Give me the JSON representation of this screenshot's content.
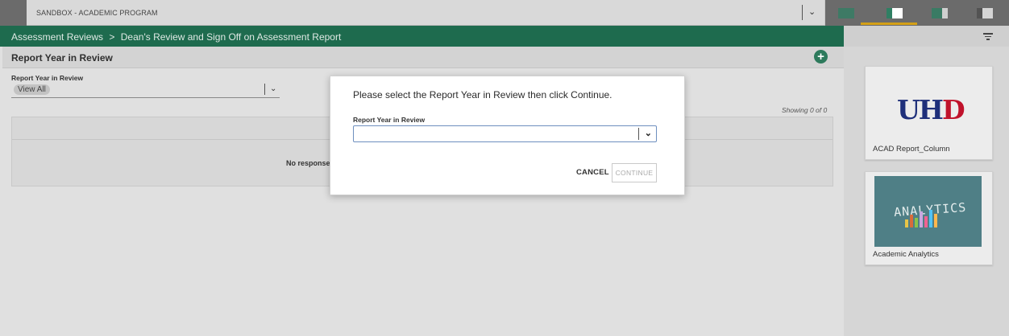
{
  "topbar": {
    "program_name": "SANDBOX - ACADEMIC PROGRAM",
    "menu_icon": "hamburger-menu-icon",
    "program_caret": "⌄",
    "view_buttons": [
      "layout-view-1-icon",
      "layout-view-2-icon",
      "layout-view-3-icon",
      "layout-view-4-icon"
    ],
    "active_view_index": 1
  },
  "breadcrumb": {
    "parent": "Assessment Reviews",
    "separator": ">",
    "current": "Dean's Review and Sign Off on Assessment Report"
  },
  "panel": {
    "title": "Report Year in Review",
    "add_icon": "plus-circle-icon",
    "add_label": "+",
    "filter_label": "Report Year in Review",
    "filter_value": "View All",
    "filter_caret": "⌄",
    "showing_text": "Showing 0 of 0",
    "empty_text": "No responses"
  },
  "sidebar": {
    "filter_icon": "filter-icon",
    "cards": [
      {
        "label": "ACAD Report_Column",
        "logo_text_main": "UH",
        "logo_text_accent": "D"
      },
      {
        "label": "Academic Analytics",
        "image_text": "ANALYTICS"
      }
    ]
  },
  "modal": {
    "message": "Please select the Report Year in Review then click Continue.",
    "field_label": "Report Year in Review",
    "field_value": "",
    "caret": "⌄",
    "cancel_label": "CANCEL",
    "continue_label": "CONTINUE"
  },
  "colors": {
    "breadcrumb_bar": "#1e6b4e",
    "accent_underline": "#d4a017",
    "add_button": "#2d7a5c",
    "logo_blue": "#1e2f7a",
    "logo_red": "#c0122b"
  }
}
